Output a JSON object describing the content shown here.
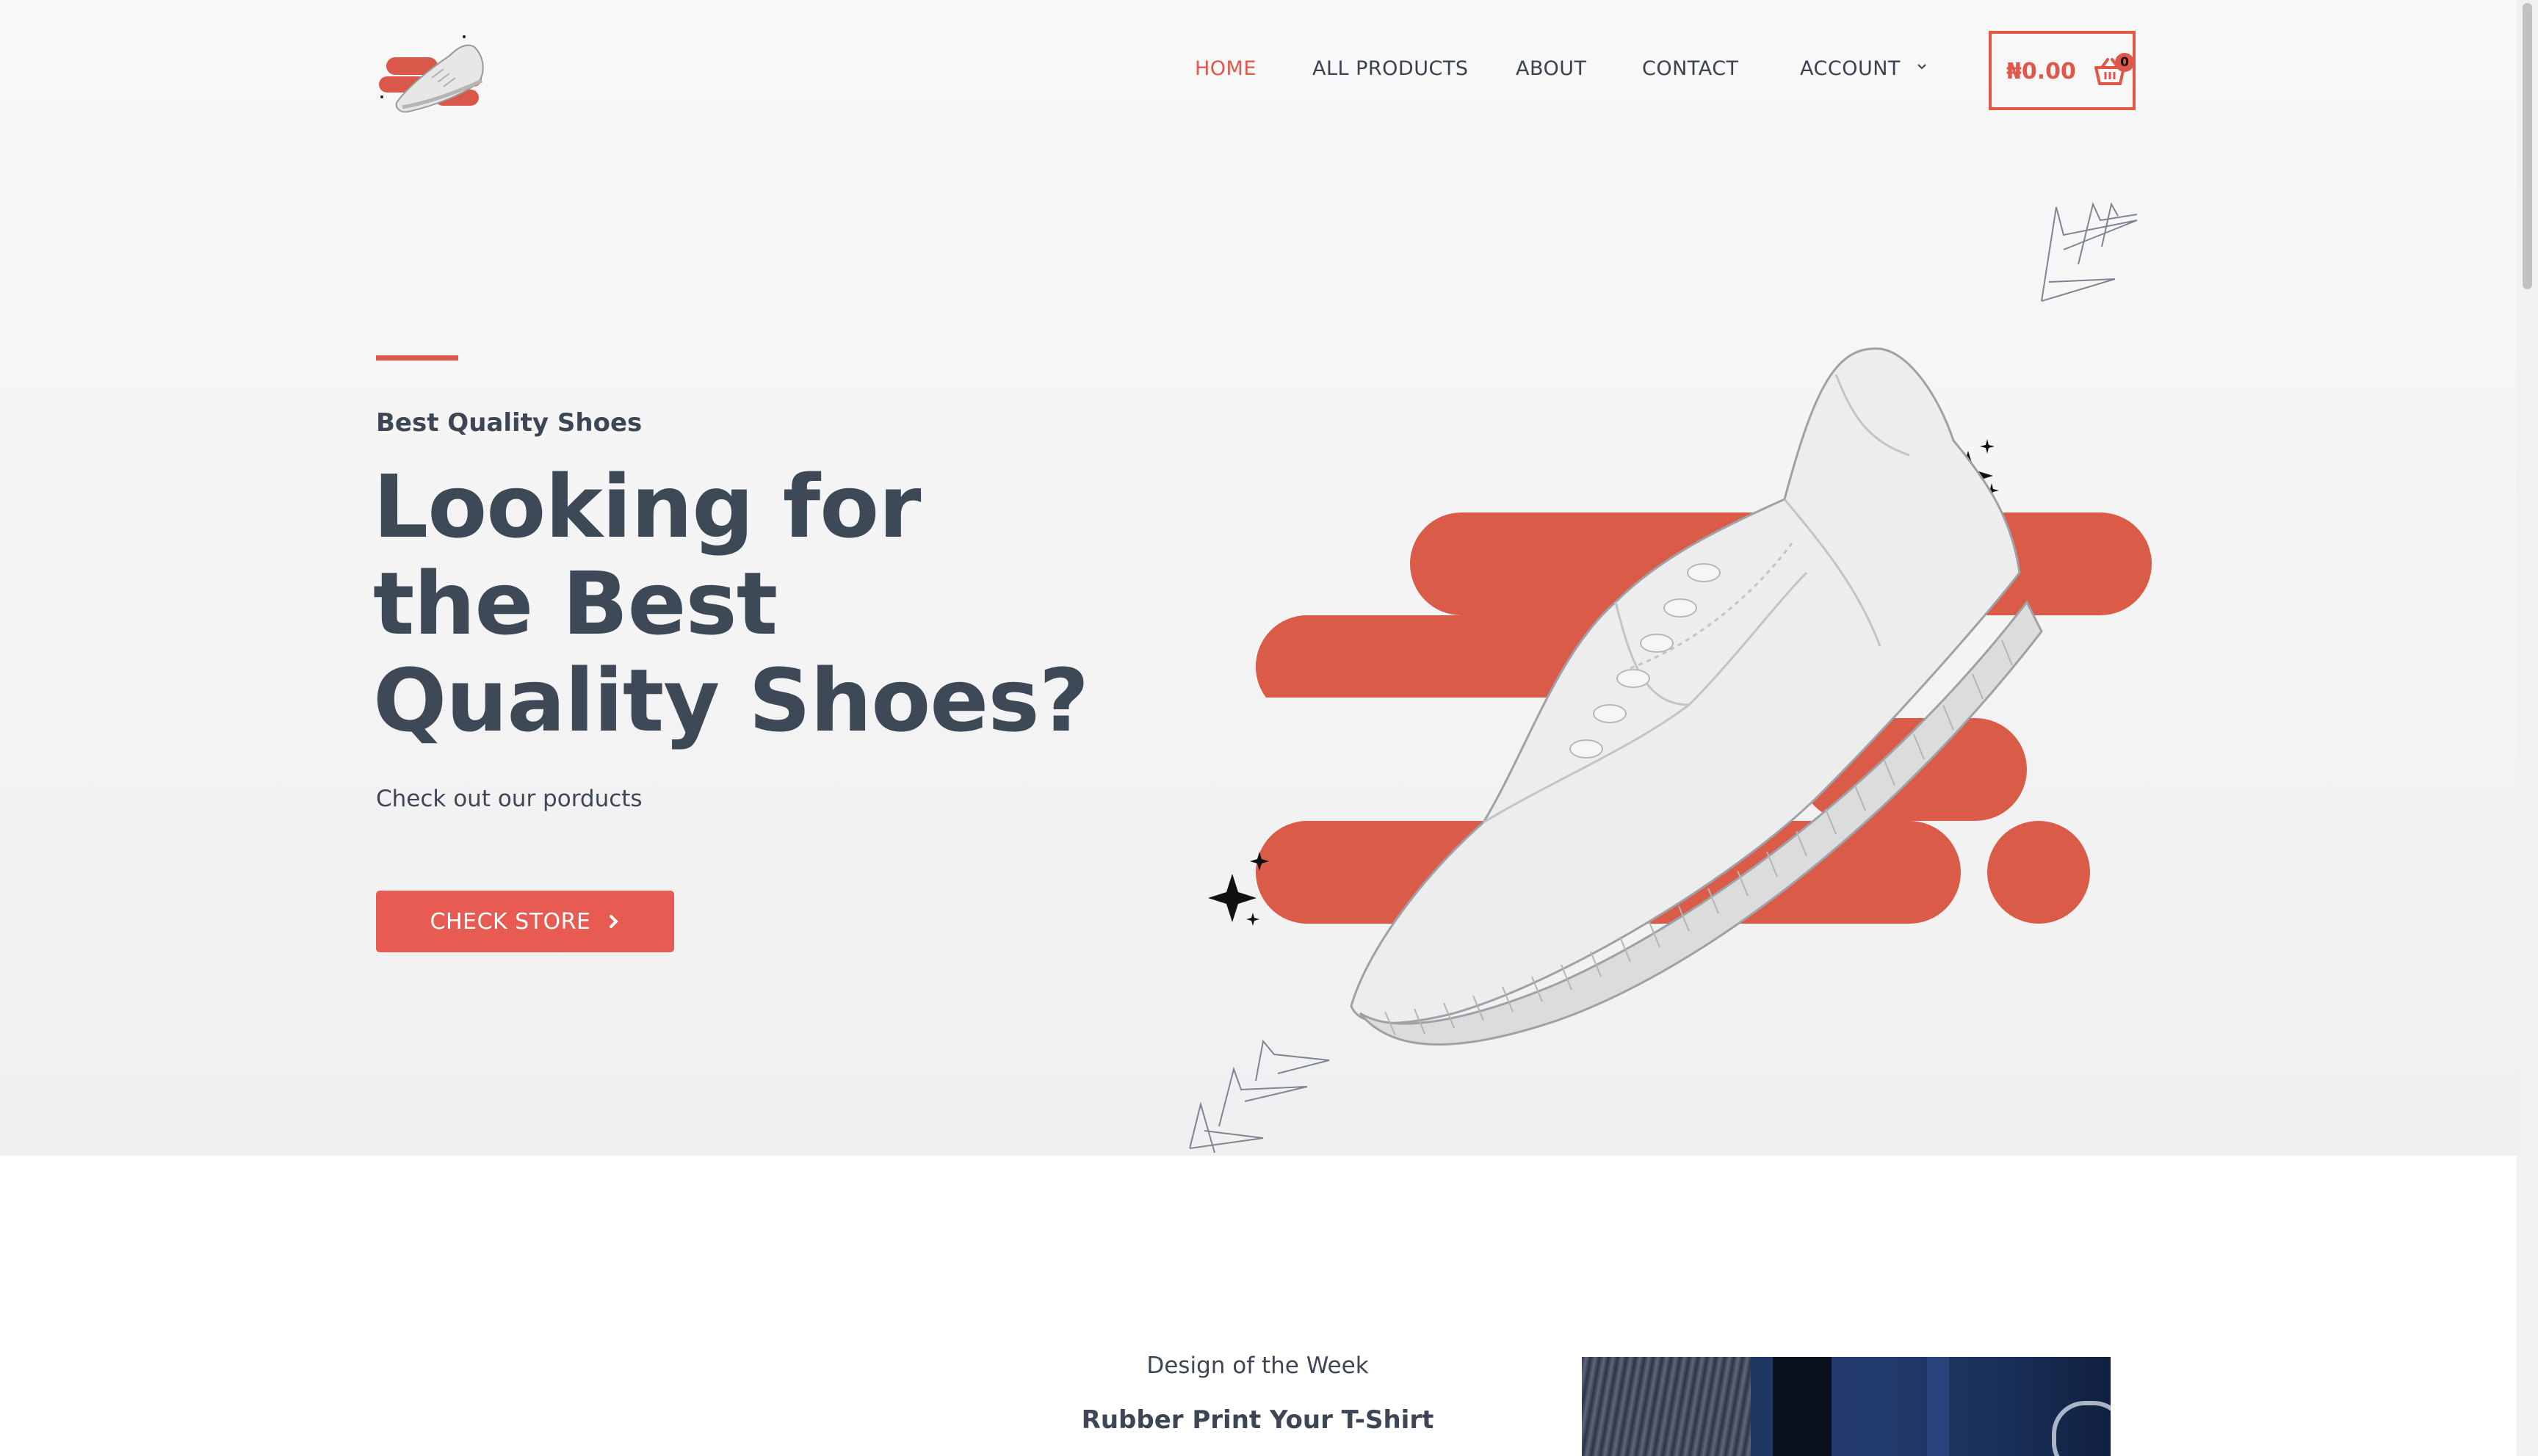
{
  "header": {
    "logo_icon": "sneaker-logo",
    "nav": [
      {
        "label": "HOME",
        "active": true
      },
      {
        "label": "ALL PRODUCTS",
        "active": false
      },
      {
        "label": "ABOUT",
        "active": false
      },
      {
        "label": "CONTACT",
        "active": false
      },
      {
        "label": "ACCOUNT",
        "active": false,
        "has_dropdown": true
      }
    ],
    "cart": {
      "total": "₦0.00",
      "count": "0",
      "icon": "basket-icon"
    }
  },
  "hero": {
    "eyebrow": "Best Quality Shoes",
    "headline": "Looking for the Best Quality Shoes?",
    "subtitle": "Check out our porducts",
    "cta_label": "CHECK STORE",
    "cta_icon": "chevron-right-icon"
  },
  "featured": {
    "label": "Design of the Week",
    "title": "Rubber Print Your T-Shirt"
  },
  "colors": {
    "accent": "#e0574a",
    "text": "#3e4957",
    "hero_bg": "#f3f3f4"
  }
}
